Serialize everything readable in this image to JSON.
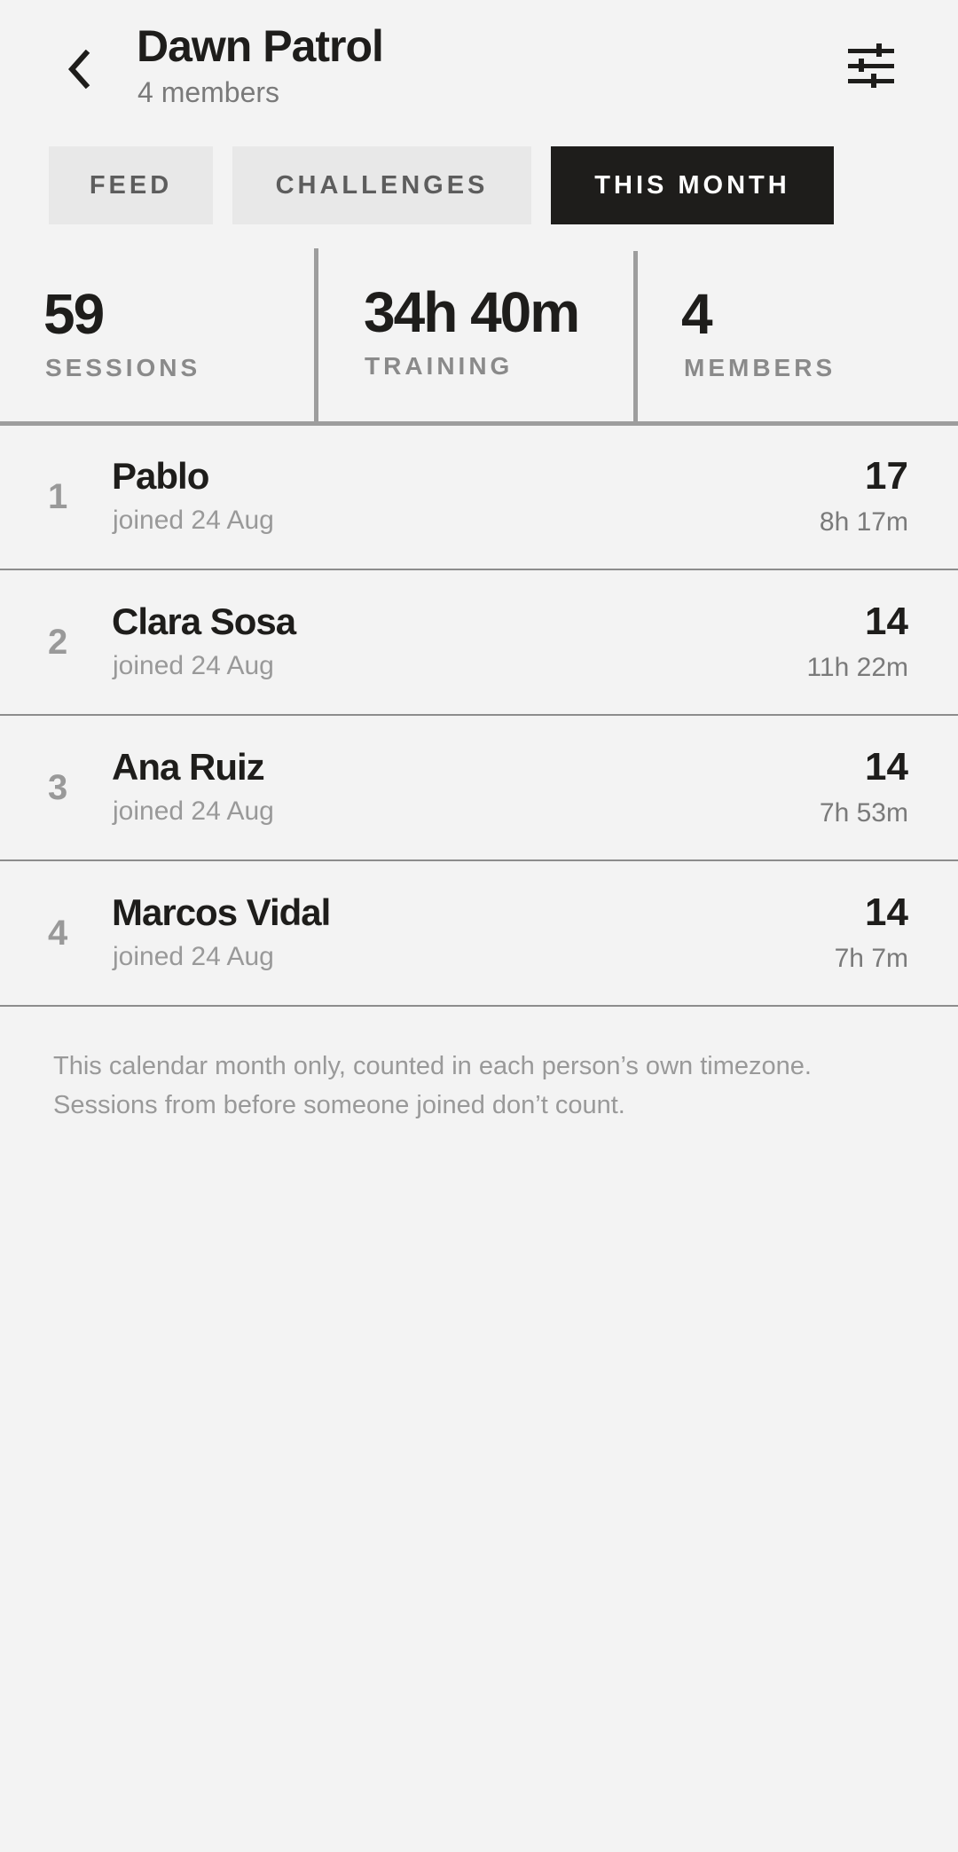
{
  "header": {
    "title": "Dawn Patrol",
    "subtitle": "4 members",
    "back_icon": "chevron-left-icon",
    "filter_icon": "sliders-icon"
  },
  "tabs": [
    {
      "label": "FEED",
      "active": false
    },
    {
      "label": "CHALLENGES",
      "active": false
    },
    {
      "label": "THIS MONTH",
      "active": true
    }
  ],
  "stats": [
    {
      "value": "59",
      "label": "SESSIONS"
    },
    {
      "value": "34h 40m",
      "label": "TRAINING"
    },
    {
      "value": "4",
      "label": "MEMBERS"
    }
  ],
  "leaderboard": [
    {
      "rank": "1",
      "name": "Pablo",
      "joined": "joined 24 Aug",
      "count": "17",
      "time": "8h 17m"
    },
    {
      "rank": "2",
      "name": "Clara Sosa",
      "joined": "joined 24 Aug",
      "count": "14",
      "time": "11h 22m"
    },
    {
      "rank": "3",
      "name": "Ana Ruiz",
      "joined": "joined 24 Aug",
      "count": "14",
      "time": "7h 53m"
    },
    {
      "rank": "4",
      "name": "Marcos Vidal",
      "joined": "joined 24 Aug",
      "count": "14",
      "time": "7h 7m"
    }
  ],
  "footnote": "This calendar month only, counted in each person’s own timezone. Sessions from before someone joined don’t count.",
  "colors": {
    "background": "#f3f3f3",
    "ink": "#1e1d1b",
    "muted": "#999999",
    "tab_inactive_bg": "#e8e8e8",
    "tab_active_bg": "#1e1d1b",
    "divider": "#9d9d9d"
  }
}
